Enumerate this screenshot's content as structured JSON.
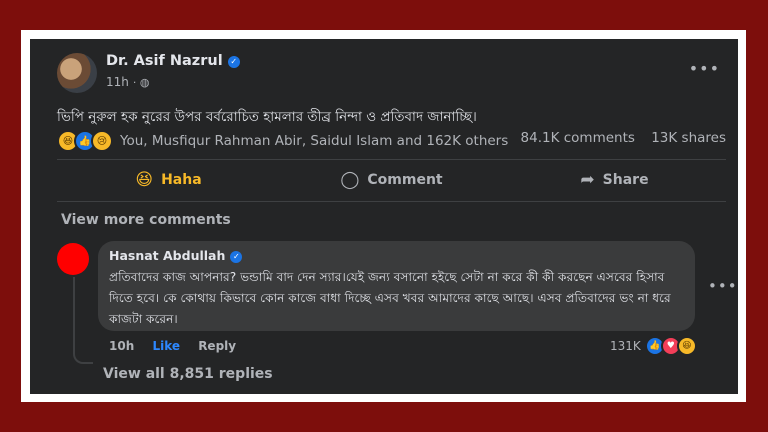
{
  "post": {
    "author": "Dr. Asif Nazrul",
    "time": "11h",
    "text": "ভিপি নুরুল হক নুরের উপর বর্বরোচিত হামলার তীব্র নিন্দা ও প্রতিবাদ জানাচ্ছি।",
    "reactions_text": "You, Musfiqur Rahman Abir, Saidul Islam and 162K others",
    "comments_count": "84.1K comments",
    "shares_count": "13K shares",
    "colors": {
      "card_bg": "#242526",
      "frame": "#7d0e0c",
      "haha": "#f7b928",
      "like_blue": "#2d88ff"
    }
  },
  "actions": {
    "haha": "Haha",
    "comment": "Comment",
    "share": "Share"
  },
  "comments": {
    "view_more": "View more comments",
    "comment": {
      "author": "Hasnat Abdullah",
      "text": "প্রতিবাদের কাজ আপনার? ভন্ডামি বাদ দেন স্যার।যেই জন্য বসানো হইছে সেটা না করে কী কী করছেন এসবের হিসাব দিতে হবে। কে কোথায় কিভাবে কোন কাজে বাধা দিচ্ছে এসব খবর আমাদের কাছে আছে। এসব প্রতিবাদের ভং না ধরে কাজটা করেন।",
      "time": "10h",
      "like": "Like",
      "reply": "Reply",
      "reaction_count": "131K"
    },
    "view_replies": "View all 8,851 replies"
  },
  "icons": [
    "avatar",
    "verified-icon",
    "globe-icon",
    "more-icon",
    "haha-icon",
    "like-icon",
    "sad-icon",
    "love-icon",
    "comment-icon",
    "share-icon"
  ]
}
